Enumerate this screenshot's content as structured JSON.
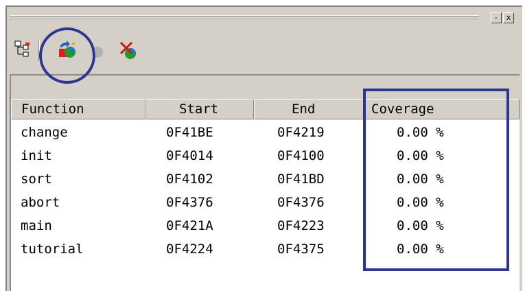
{
  "titlebar": {
    "minimize_label": "-",
    "close_label": "x"
  },
  "toolbar": {
    "icons": [
      "tree-view-icon",
      "coverage-update-icon",
      "disabled-gear-icon",
      "clear-coverage-icon"
    ]
  },
  "table": {
    "columns": [
      "Function",
      "Start",
      "End",
      "Coverage"
    ],
    "rows": [
      {
        "function": "change",
        "start": "0F41BE",
        "end": "0F4219",
        "coverage": "0.00 %"
      },
      {
        "function": "init",
        "start": "0F4014",
        "end": "0F4100",
        "coverage": "0.00 %"
      },
      {
        "function": "sort",
        "start": "0F4102",
        "end": "0F41BD",
        "coverage": "0.00 %"
      },
      {
        "function": "abort",
        "start": "0F4376",
        "end": "0F4376",
        "coverage": "0.00 %"
      },
      {
        "function": "main",
        "start": "0F421A",
        "end": "0F4223",
        "coverage": "0.00 %"
      },
      {
        "function": "tutorial",
        "start": "0F4224",
        "end": "0F4375",
        "coverage": "0.00 %"
      }
    ]
  },
  "colors": {
    "annotation": "#2e3590",
    "panel": "#d4d0c8"
  }
}
